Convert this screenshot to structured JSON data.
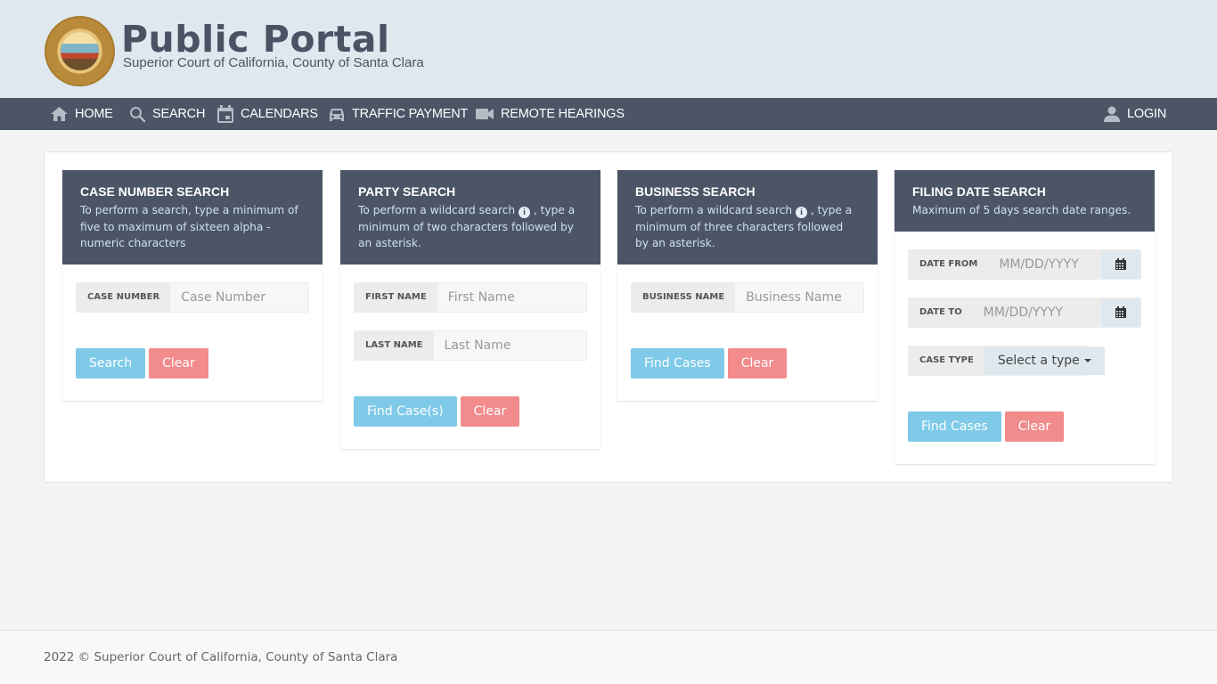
{
  "header": {
    "logo_alt": "Superior Court of California, County of Santa Clara seal",
    "title": "Public Portal",
    "subtitle": "Superior Court of California, County of Santa Clara"
  },
  "nav": {
    "items": [
      {
        "label": "HOME",
        "icon": "home-icon"
      },
      {
        "label": "SEARCH",
        "icon": "search-icon"
      },
      {
        "label": "CALENDARS",
        "icon": "calendar-icon"
      },
      {
        "label": "TRAFFIC PAYMENT",
        "icon": "car-icon"
      },
      {
        "label": "REMOTE HEARINGS",
        "icon": "video-camera-icon"
      }
    ],
    "login": {
      "label": "LOGIN",
      "icon": "user-icon"
    }
  },
  "cards": {
    "case_number": {
      "title": "CASE NUMBER SEARCH",
      "desc": "To perform a search, type a minimum of five to maximum of sixteen alpha - numeric characters",
      "field_label": "CASE NUMBER",
      "field_placeholder": "Case Number",
      "field_value": "",
      "primary_btn": "Search",
      "clear_btn": "Clear"
    },
    "party": {
      "title": "PARTY SEARCH",
      "desc_before": "To perform a wildcard search",
      "desc_after": ", type a minimum of two characters followed by an asterisk.",
      "info_icon": "i",
      "first_label": "FIRST NAME",
      "first_placeholder": "First Name",
      "first_value": "",
      "last_label": "LAST NAME",
      "last_placeholder": "Last Name",
      "last_value": "",
      "primary_btn": "Find Case(s)",
      "clear_btn": "Clear"
    },
    "business": {
      "title": "BUSINESS SEARCH",
      "desc_before": "To perform a wildcard search",
      "desc_after": ", type a minimum of three characters followed by an asterisk.",
      "info_icon": "i",
      "field_label": "BUSINESS NAME",
      "field_placeholder": "Business Name",
      "field_value": "",
      "primary_btn": "Find Cases",
      "clear_btn": "Clear"
    },
    "filing_date": {
      "title": "FILING DATE SEARCH",
      "desc": "Maximum of 5 days search date ranges.",
      "date_from_label": "DATE FROM",
      "date_from_placeholder": "MM/DD/YYYY",
      "date_from_value": "",
      "date_to_label": "DATE TO",
      "date_to_placeholder": "MM/DD/YYYY",
      "date_to_value": "",
      "case_type_label": "CASE TYPE",
      "case_type_selected": "Select a type",
      "primary_btn": "Find Cases",
      "clear_btn": "Clear"
    }
  },
  "footer": {
    "text": "2022 © Superior Court of California, County of Santa Clara"
  },
  "colors": {
    "header_bg": "#dfe8ee",
    "nav_bg": "#4c5566",
    "primary": "#7ecae8",
    "danger": "#f28b8b"
  }
}
